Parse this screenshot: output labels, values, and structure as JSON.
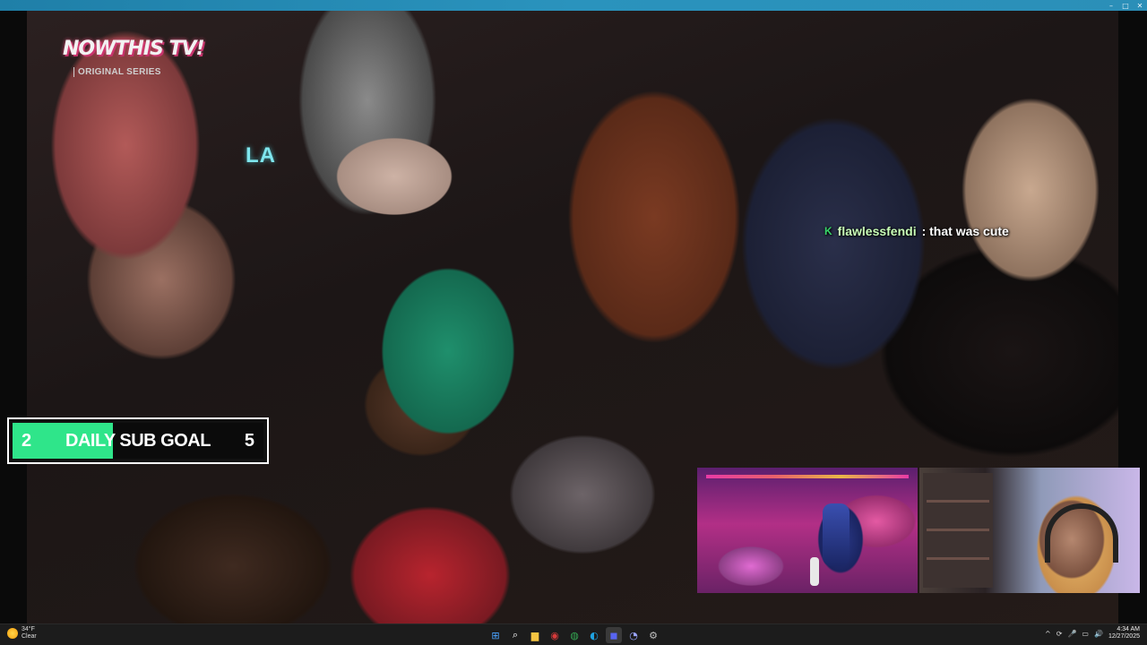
{
  "window": {
    "controls": {
      "minimize": "–",
      "maximize": "□",
      "close": "✕"
    }
  },
  "video": {
    "logo_text": "NOWTHIS TV!",
    "logo_subtitle": "ORIGINAL SERIES",
    "location_label": "LA"
  },
  "chat": {
    "badge": "K",
    "username": "flawlessfendi",
    "message": ": that was cute"
  },
  "sub_goal": {
    "current": "2",
    "label": "DAILY SUB GOAL",
    "target": "5",
    "progress_fraction": 0.4,
    "fill_color": "#2fe58a"
  },
  "taskbar": {
    "weather": {
      "temp": "34°F",
      "condition": "Clear"
    },
    "apps": [
      {
        "name": "windows-start-icon",
        "glyph": "⊞",
        "color": "#4aa3ff"
      },
      {
        "name": "search-icon",
        "glyph": "⌕",
        "color": "#ffffff"
      },
      {
        "name": "file-explorer-icon",
        "glyph": "▆",
        "color": "#f5c542"
      },
      {
        "name": "obs-icon",
        "glyph": "◉",
        "color": "#d63a3a"
      },
      {
        "name": "chrome-icon",
        "glyph": "◍",
        "color": "#34a853"
      },
      {
        "name": "edge-icon",
        "glyph": "◐",
        "color": "#1fa2e0"
      },
      {
        "name": "discord-icon",
        "glyph": "◼",
        "color": "#5865f2"
      },
      {
        "name": "app-icon",
        "glyph": "◔",
        "color": "#9aa4ff"
      },
      {
        "name": "settings-icon",
        "glyph": "⚙",
        "color": "#c0c0c0"
      }
    ],
    "tray_icons": [
      "^",
      "⟳",
      "🎤",
      "▭",
      "🔊"
    ],
    "time": "4:34 AM",
    "date": "12/27/2025"
  }
}
